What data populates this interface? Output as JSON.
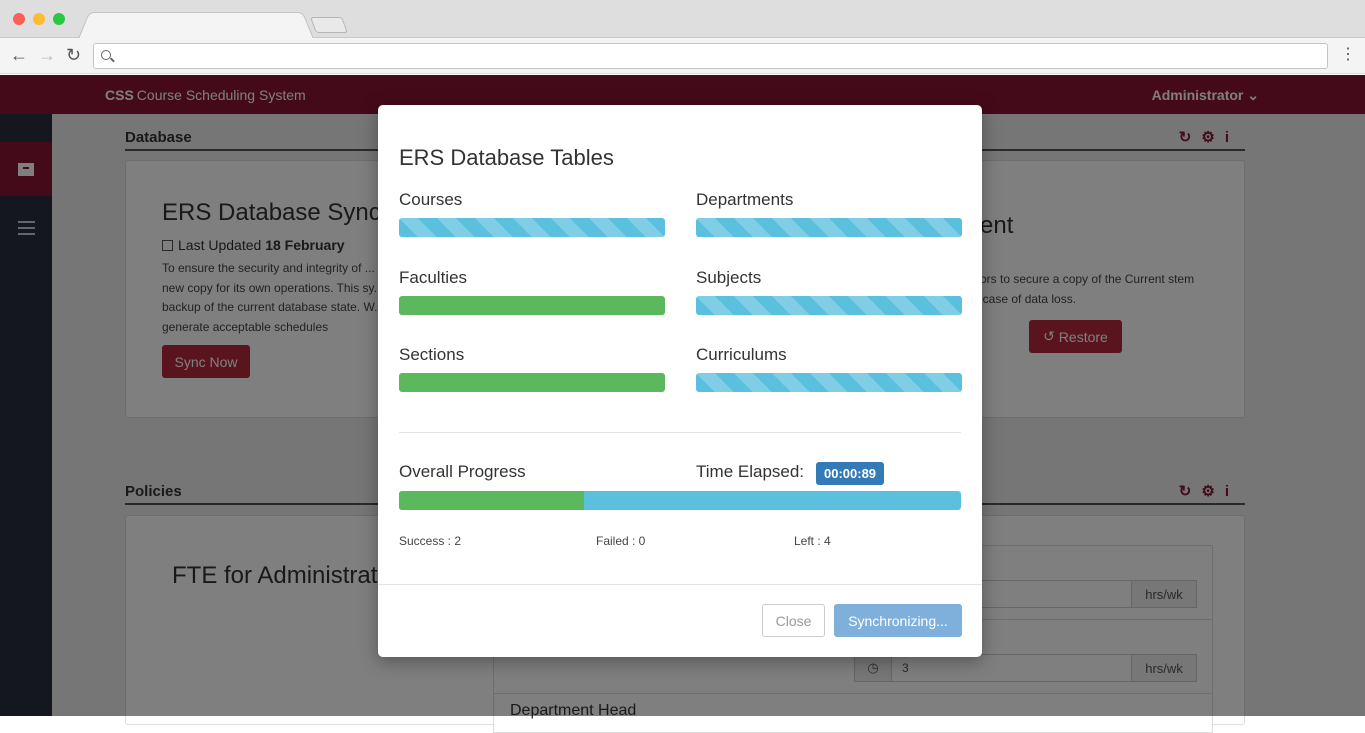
{
  "app": {
    "brand_short": "CSS",
    "brand_full": "Course Scheduling System",
    "user_menu": "Administrator"
  },
  "database_section": {
    "title": "Database"
  },
  "policies_section": {
    "title": "Policies"
  },
  "sync_panel": {
    "title": "ERS Database Sync",
    "last_updated_label": "Last Updated",
    "last_updated_value": "18 February",
    "info": "To ensure the security and integrity of ... new copy for its own operations. This sy... backup of the current database state. W... generate acceptable schedules",
    "sync_button": "Sync Now"
  },
  "restore_panel": {
    "title_fragment": "ment",
    "info": "ators to secure a copy of the Current stem in case of data loss.",
    "restore_button": "Restore"
  },
  "fte_panel": {
    "title": "FTE for Administrat",
    "unit": "hrs/wk",
    "value2": "3",
    "dept_head": "Department Head"
  },
  "modal": {
    "title": "ERS Database Tables",
    "tables": [
      {
        "label": "Courses",
        "status": "pending"
      },
      {
        "label": "Departments",
        "status": "pending"
      },
      {
        "label": "Faculties",
        "status": "done"
      },
      {
        "label": "Subjects",
        "status": "pending"
      },
      {
        "label": "Sections",
        "status": "done"
      },
      {
        "label": "Curriculums",
        "status": "pending"
      }
    ],
    "overall_label": "Overall Progress",
    "overall_progress": 0.33,
    "time_label": "Time Elapsed:",
    "time_value": "00:00:89",
    "success_text": "Success : 2",
    "failed_text": "Failed : 0",
    "left_text": "Left : 4",
    "close_button": "Close",
    "sync_button": "Synchronizing..."
  },
  "colors": {
    "brand": "#8a1533",
    "success": "#5cb85c",
    "info": "#5bc0de",
    "primary": "#337ab7"
  }
}
